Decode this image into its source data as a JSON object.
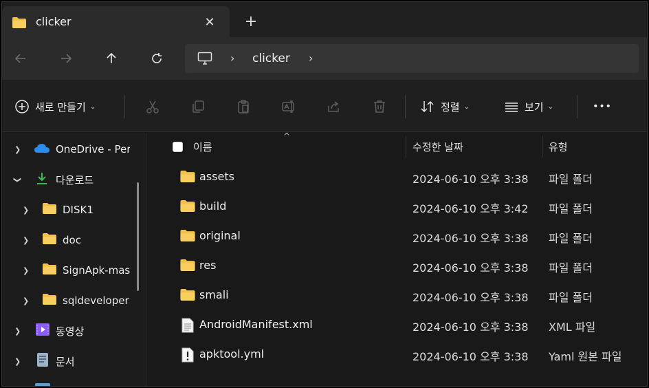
{
  "tab": {
    "title": "clicker",
    "close_glyph": "✕",
    "new_glyph": "+"
  },
  "address": {
    "crumbs": [
      "clicker"
    ],
    "chevron": "›"
  },
  "toolbar": {
    "new_label": "새로 만들기",
    "sort_label": "정렬",
    "view_label": "보기",
    "more_glyph": "•••",
    "dropdown_glyph": "⌄"
  },
  "sidebar": {
    "items": [
      {
        "label": "OneDrive - Per",
        "icon": "cloud-icon",
        "expanded": false
      },
      {
        "label": "다운로드",
        "icon": "download-icon",
        "expanded": true
      },
      {
        "label": "DISK1",
        "icon": "folder-icon",
        "expanded": false
      },
      {
        "label": "doc",
        "icon": "folder-icon",
        "expanded": false
      },
      {
        "label": "SignApk-mas",
        "icon": "folder-icon",
        "expanded": false
      },
      {
        "label": "sqldeveloper",
        "icon": "folder-icon",
        "expanded": false
      },
      {
        "label": "동영상",
        "icon": "video-icon",
        "expanded": false
      },
      {
        "label": "문서",
        "icon": "document-icon",
        "expanded": false
      }
    ]
  },
  "columns": {
    "name": "이름",
    "date": "수정한 날짜",
    "type": "유형"
  },
  "files": [
    {
      "name": "assets",
      "date": "2024-06-10 오후 3:38",
      "type": "파일 폴더",
      "icon": "folder-icon"
    },
    {
      "name": "build",
      "date": "2024-06-10 오후 3:42",
      "type": "파일 폴더",
      "icon": "folder-icon"
    },
    {
      "name": "original",
      "date": "2024-06-10 오후 3:38",
      "type": "파일 폴더",
      "icon": "folder-icon"
    },
    {
      "name": "res",
      "date": "2024-06-10 오후 3:38",
      "type": "파일 폴더",
      "icon": "folder-icon"
    },
    {
      "name": "smali",
      "date": "2024-06-10 오후 3:38",
      "type": "파일 폴더",
      "icon": "folder-icon"
    },
    {
      "name": "AndroidManifest.xml",
      "date": "2024-06-10 오후 3:38",
      "type": "XML 파일",
      "icon": "xml-file-icon"
    },
    {
      "name": "apktool.yml",
      "date": "2024-06-10 오후 3:38",
      "type": "Yaml 원본 파일",
      "icon": "yaml-file-icon"
    }
  ],
  "colors": {
    "folder": "#f3c14b",
    "accent_green": "#3fb950",
    "onedrive_blue": "#2f8ce8",
    "video_purple": "#8b5cf6"
  }
}
